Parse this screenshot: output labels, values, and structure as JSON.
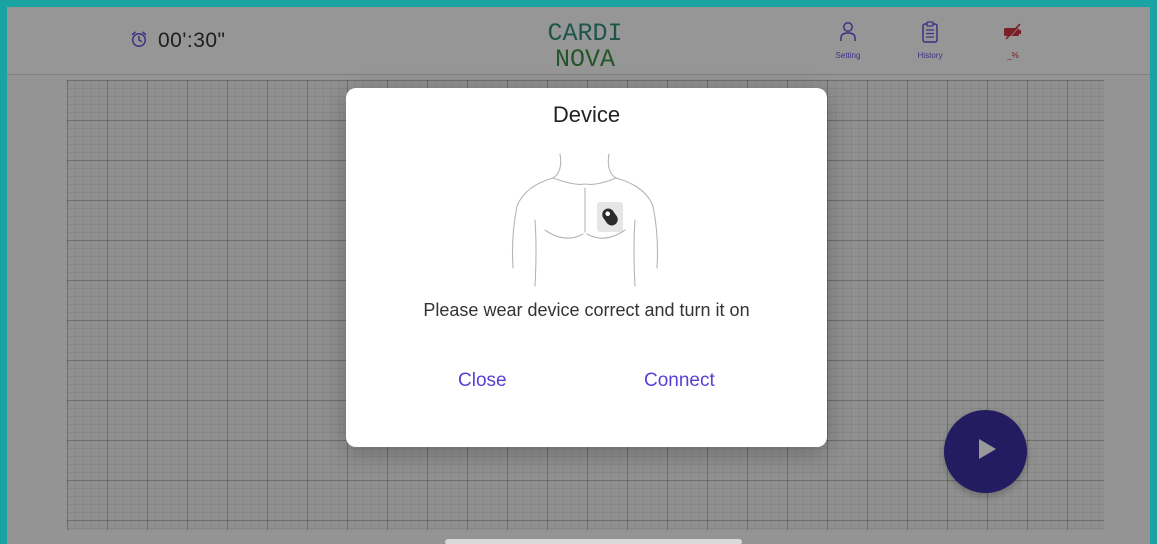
{
  "header": {
    "timer": "00':30\"",
    "timer_icon": "alarm-clock-icon",
    "logo": {
      "line1": "CARDI",
      "line2": "NOVA"
    },
    "buttons": [
      {
        "icon": "person-icon",
        "label": "Setting"
      },
      {
        "icon": "clipboard-icon",
        "label": "History"
      },
      {
        "icon": "battery-off-icon",
        "label": "_%"
      }
    ]
  },
  "dialog": {
    "title": "Device",
    "illustration": "chest-device-illustration",
    "message": "Please wear device correct and turn it on",
    "close_label": "Close",
    "connect_label": "Connect"
  },
  "play_button": {
    "icon": "play-icon"
  },
  "colors": {
    "accent": "#5a3fd6",
    "play_button": "#3d2fa0",
    "logo_top": "#2f8f7a",
    "logo_bottom": "#3a8f45",
    "frame": "#1aa3a3",
    "battery_icon": "#cc3344"
  }
}
